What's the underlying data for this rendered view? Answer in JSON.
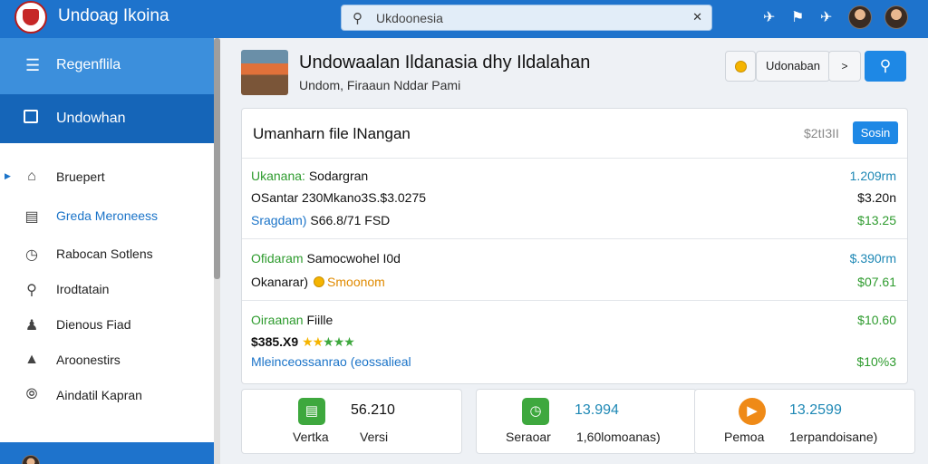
{
  "app": {
    "title": "Undoag Ikoina"
  },
  "search": {
    "value": "Ukdoonesia"
  },
  "topbar": {
    "icons": [
      "plane-icon",
      "bell-alert-icon",
      "plane-icon-2",
      "user-avatar",
      "user-avatar-2"
    ]
  },
  "sidebar": {
    "header": {
      "icon": "menu-icon",
      "label": "Regenflila"
    },
    "active": {
      "icon": "folder-icon",
      "label": "Undowhan"
    },
    "items": [
      {
        "icon": "home-icon",
        "label": "Bruepert"
      },
      {
        "icon": "document-icon",
        "label": "Greda Meroneess"
      },
      {
        "icon": "chart-icon",
        "label": "Rabocan Sotlens"
      },
      {
        "icon": "search-icon",
        "label": "Irodtatain"
      },
      {
        "icon": "users-icon",
        "label": "Dienous Fiad"
      },
      {
        "icon": "analytics-icon",
        "label": "Aroonestirs"
      },
      {
        "icon": "compass-icon",
        "label": "Aindatil Kapran"
      }
    ]
  },
  "header": {
    "title": "Undowaalan Ildanasia dhy Ildalahan",
    "subtitle": "Undom, Firaaun Nddar Pami",
    "lang_button": "Udonaban",
    "next_glyph": ">"
  },
  "card": {
    "title": "Umanharn file lNangan",
    "total": "$2tI3II",
    "button": "Sosin",
    "group1": {
      "line1_label": "Ukanana:",
      "line1_text": "Sodargran",
      "line1_value": "1.209rm",
      "line2_text": "OSantar 230Mkano3S.$3.0275",
      "line2_value": "$3.20n",
      "line3_label": "Sragdam)",
      "line3_text": "S66.8/71 FSD",
      "line3_value": "$13.25"
    },
    "group2": {
      "line1_label": "Ofidaram",
      "line1_text": "Samocwohel I0d",
      "line1_value": "$.390rm",
      "line2_text": "Okanarar)",
      "line2_badge": "Smoonom",
      "line2_value": "$07.61"
    },
    "group3": {
      "line1_label": "Oiraanan",
      "line1_text": "Fiille",
      "line1_value": "$10.60",
      "line2_price": "$385.X9",
      "line2_rating": "★★★★★",
      "line2_value": "",
      "line3_text": "Mleinceossanrao (eossalieal",
      "line3_value": "$10%3"
    }
  },
  "stats": [
    {
      "icon": "document-icon",
      "color": "#3ea83e",
      "value": "56.210",
      "label": "Vertka",
      "sub": "Versi"
    },
    {
      "icon": "chart-icon",
      "color": "#3ea83e",
      "value": "13.994",
      "label": "Seraoar",
      "sub": "1,60lomoanas)"
    },
    {
      "icon": "play-icon",
      "color": "#ef8a17",
      "value": "13.2599",
      "label": "Pemoa",
      "sub": "1erpandoisane)"
    }
  ]
}
